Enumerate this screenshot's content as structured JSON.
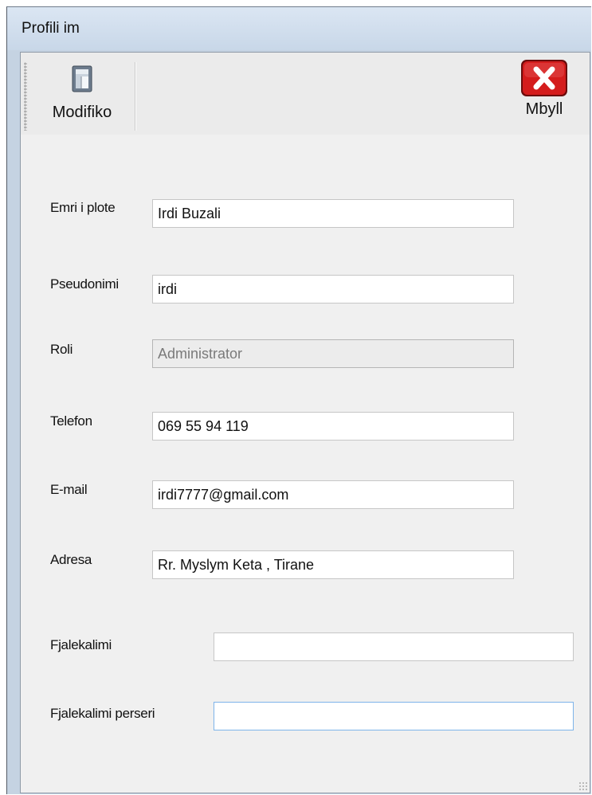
{
  "window": {
    "title": "Profili im"
  },
  "toolbar": {
    "modify_label": "Modifiko",
    "modify_icon": "document-edit-icon",
    "close_label": "Mbyll",
    "close_icon": "close-icon",
    "close_color": "#d41c1c"
  },
  "form": {
    "full_name": {
      "label": "Emri i plote",
      "value": "Irdi Buzali"
    },
    "nickname": {
      "label": "Pseudonimi",
      "value": "irdi"
    },
    "role": {
      "label": "Roli",
      "value": "Administrator"
    },
    "phone": {
      "label": "Telefon",
      "value": "069 55 94 119"
    },
    "email": {
      "label": "E-mail",
      "value": "irdi7777@gmail.com"
    },
    "address": {
      "label": "Adresa",
      "value": "Rr. Myslym Keta , Tirane"
    },
    "password": {
      "label": "Fjalekalimi",
      "value": ""
    },
    "password_repeat": {
      "label": "Fjalekalimi perseri",
      "value": ""
    }
  }
}
